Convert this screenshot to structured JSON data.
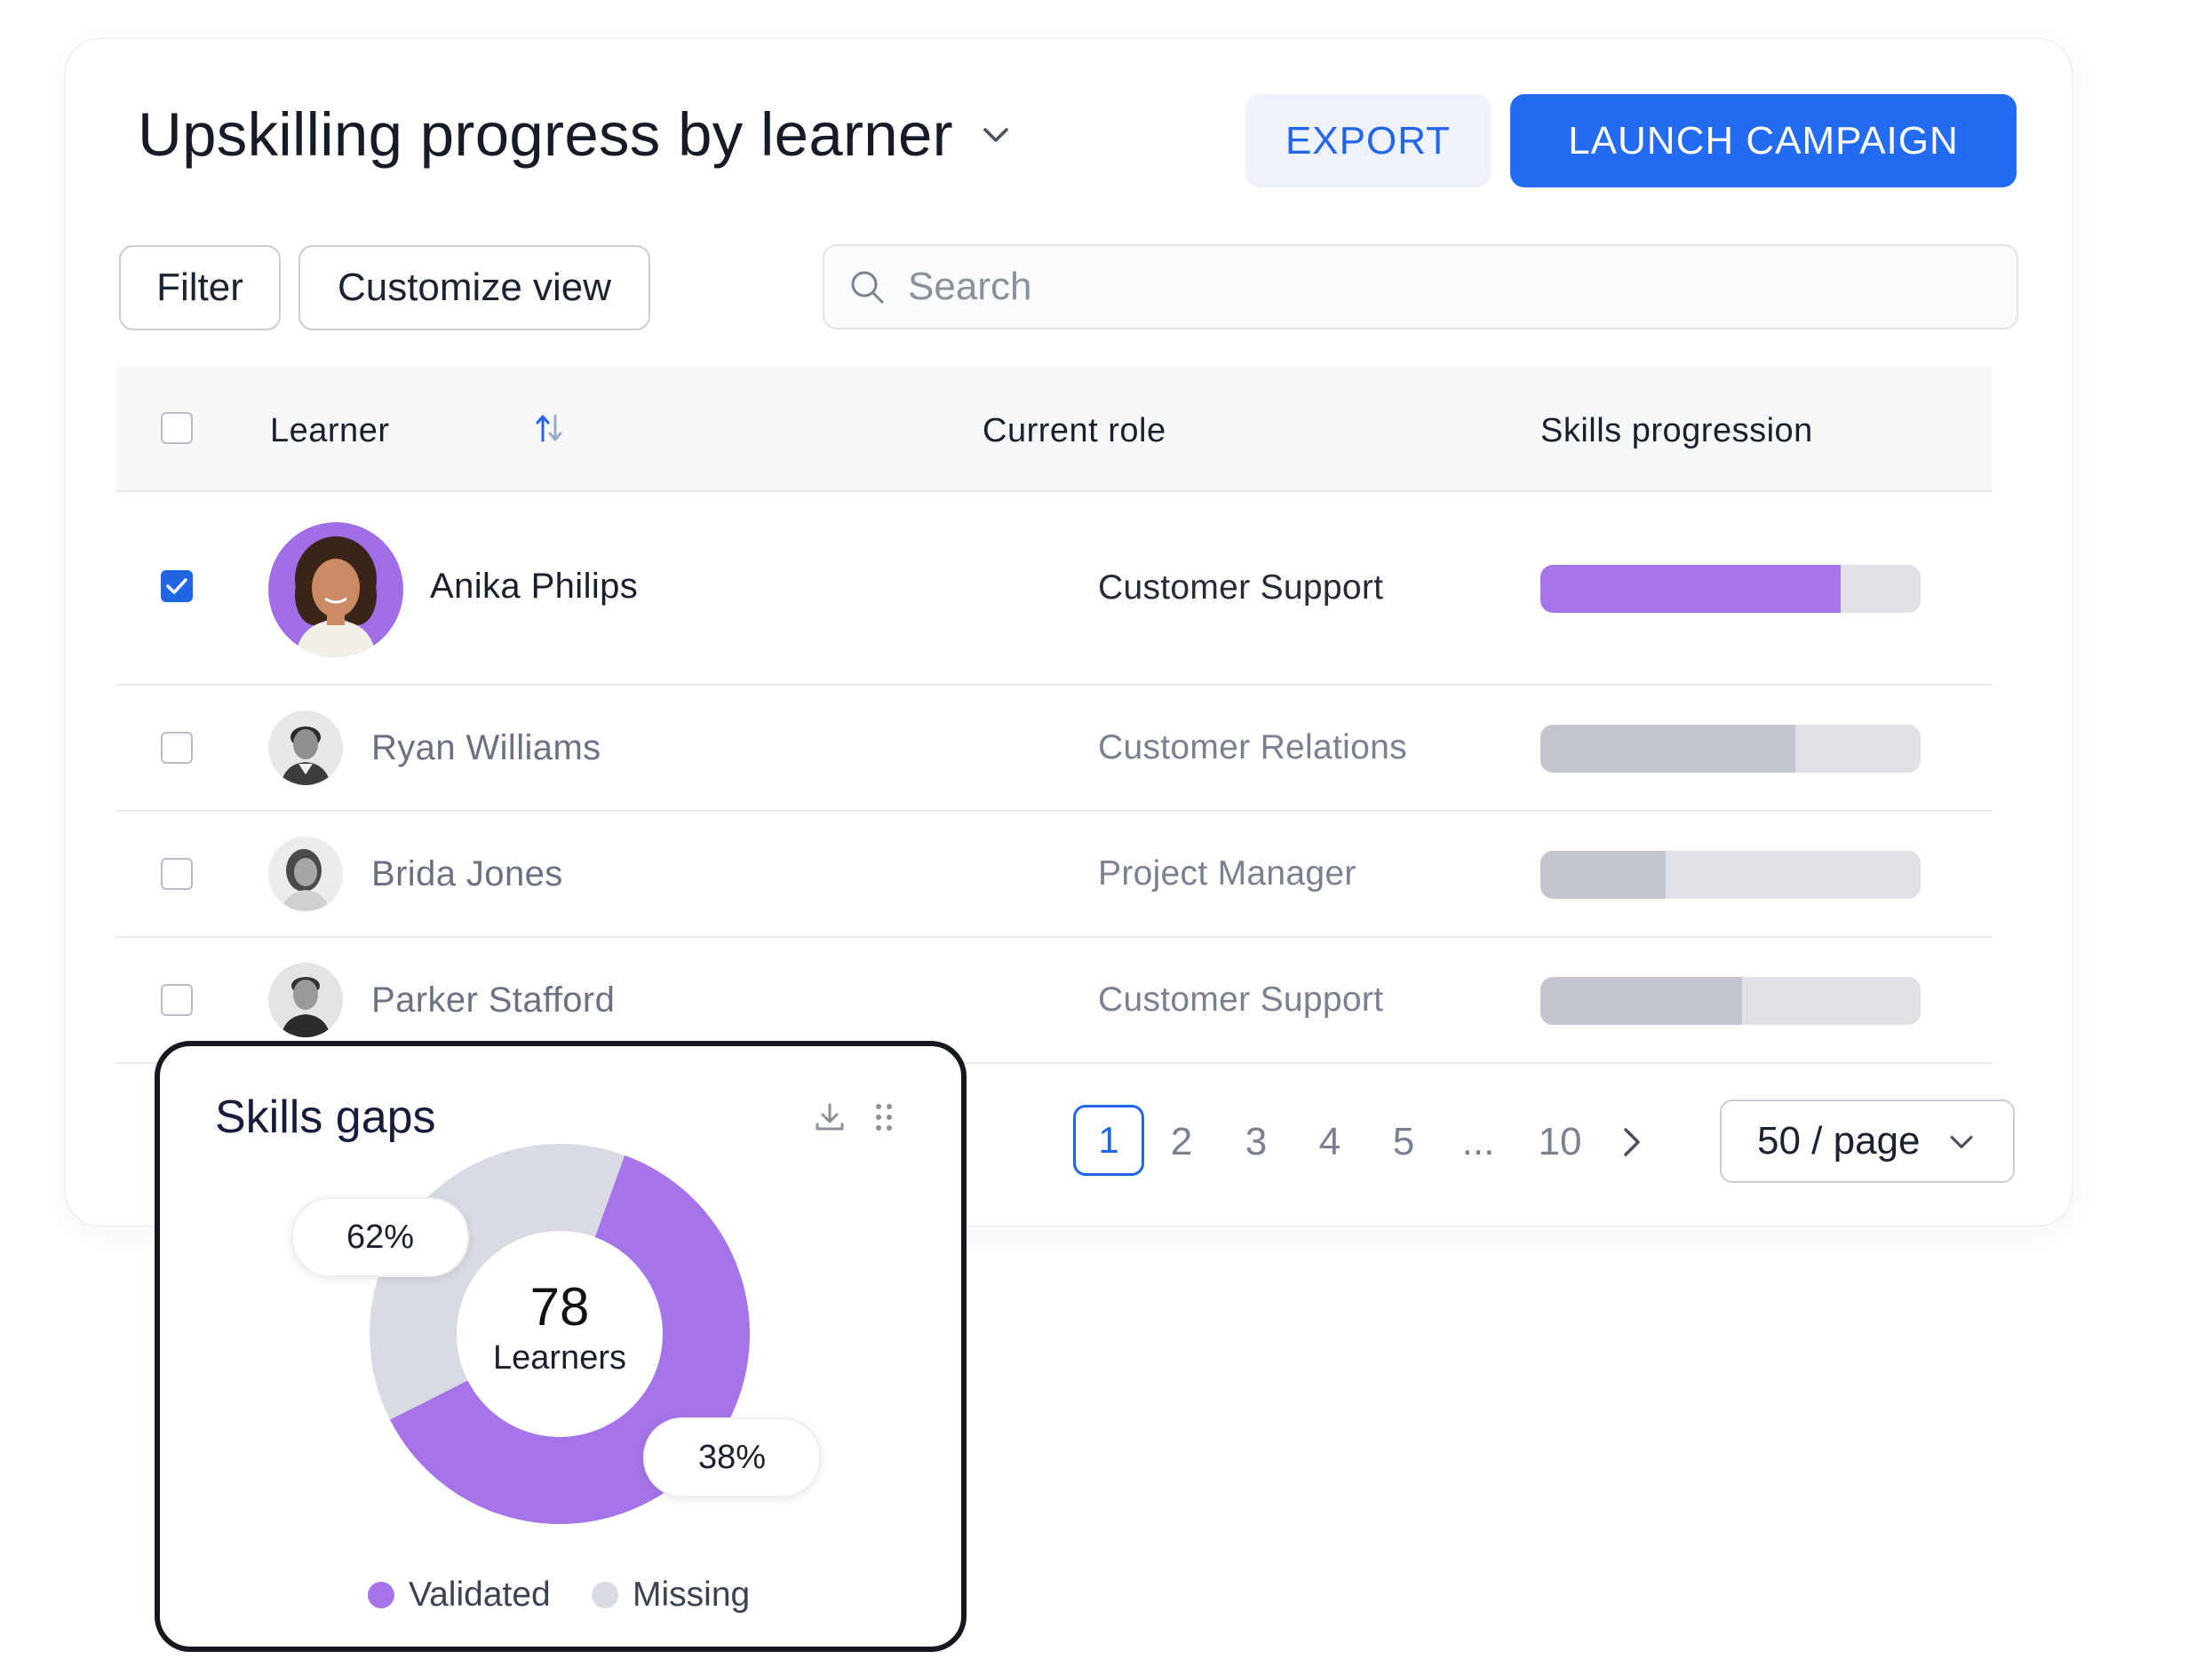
{
  "header": {
    "title": "Upskilling progress by learner",
    "export_label": "EXPORT",
    "launch_label": "LAUNCH CAMPAIGN"
  },
  "toolbar": {
    "filter_label": "Filter",
    "customize_label": "Customize view",
    "search_placeholder": "Search"
  },
  "table": {
    "columns": [
      "Learner",
      "Current role",
      "Skills progression"
    ],
    "rows": [
      {
        "name": "Anika Philips",
        "role": "Customer Support",
        "progress": 0.79,
        "selected": true
      },
      {
        "name": "Ryan Williams",
        "role": "Customer Relations",
        "progress": 0.67,
        "selected": false
      },
      {
        "name": "Brida Jones",
        "role": "Project Manager",
        "progress": 0.33,
        "selected": false
      },
      {
        "name": "Parker Stafford",
        "role": "Customer Support",
        "progress": 0.53,
        "selected": false
      }
    ]
  },
  "pagination": {
    "current": "1",
    "pages": [
      "2",
      "3",
      "4",
      "5",
      "...",
      "10"
    ],
    "per_page": "50 / page"
  },
  "widget": {
    "title": "Skills gaps",
    "center_value": "78",
    "center_label": "Learners",
    "validated_pct": "62%",
    "missing_pct": "38%",
    "legend_validated": "Validated",
    "legend_missing": "Missing"
  },
  "chart_data": {
    "type": "pie",
    "title": "Skills gaps",
    "categories": [
      "Validated",
      "Missing"
    ],
    "values": [
      62,
      38
    ],
    "center_text": "78 Learners",
    "legend_position": "bottom"
  },
  "colors": {
    "accent_blue": "#236bf0",
    "validated_purple": "#a574e8",
    "missing_gray": "#d8dbe1",
    "inactive_bar": "#c3c6cd"
  }
}
